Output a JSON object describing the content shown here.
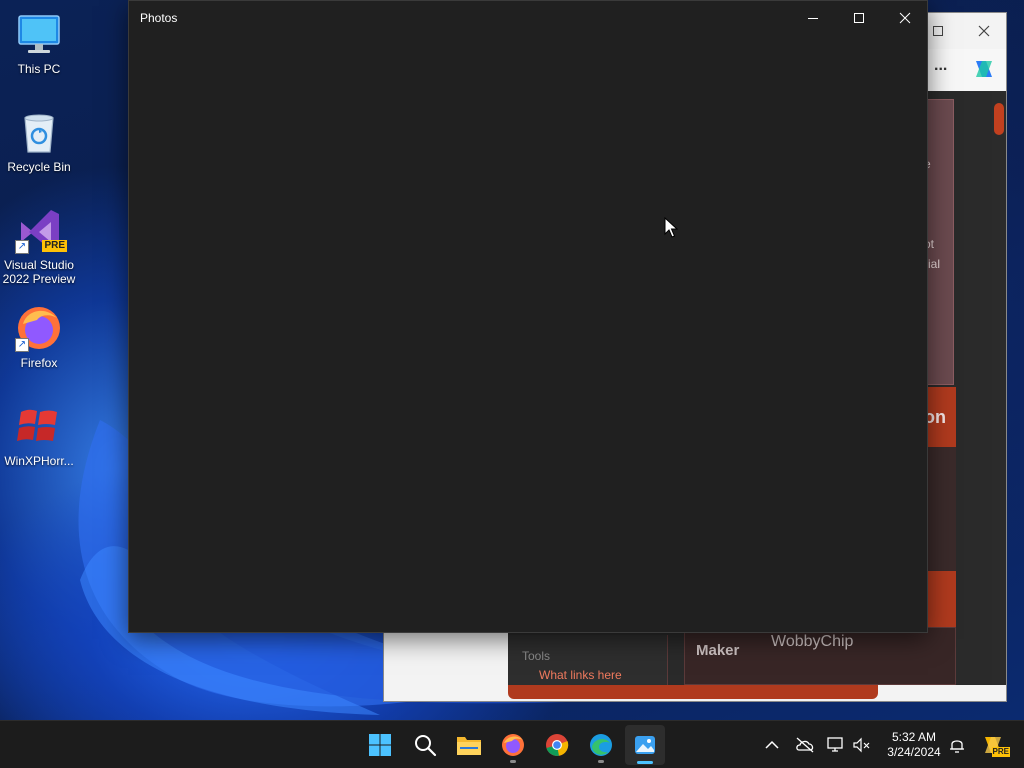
{
  "desktop": {
    "icons": [
      {
        "label": "This PC",
        "icon": "monitor-icon"
      },
      {
        "label": "Recycle Bin",
        "icon": "recycle-bin-icon"
      },
      {
        "label": "Visual Studio 2022 Preview",
        "icon": "visual-studio-icon",
        "badge": "PRE"
      },
      {
        "label": "Firefox",
        "icon": "firefox-icon"
      },
      {
        "label": "WinXPHorr...",
        "icon": "windows-flag-icon"
      }
    ]
  },
  "photos_window": {
    "title": "Photos",
    "minimize_icon": "minimize-icon",
    "maximize_icon": "maximize-icon",
    "close_icon": "close-icon"
  },
  "browser_window": {
    "more_label": "...",
    "copilot_icon": "copilot-icon",
    "visible_text": {
      "frag_e": "e",
      "frag_ot": "ot",
      "frag_rial": "rial",
      "frag_on": "on",
      "tools_heading": "Tools",
      "what_links_here": "What links here",
      "maker_label": "Maker",
      "maker_value": "WobbyChip"
    }
  },
  "taskbar": {
    "apps": [
      {
        "name": "start-button",
        "icon": "windows-logo-icon"
      },
      {
        "name": "search-button",
        "icon": "search-icon"
      },
      {
        "name": "file-explorer-button",
        "icon": "folder-icon"
      },
      {
        "name": "firefox-taskbar-button",
        "icon": "firefox-icon"
      },
      {
        "name": "chrome-taskbar-button",
        "icon": "chrome-icon"
      },
      {
        "name": "edge-taskbar-button",
        "icon": "edge-icon"
      },
      {
        "name": "photos-taskbar-button",
        "icon": "photos-icon",
        "active": true
      }
    ],
    "tray": {
      "time": "5:32 AM",
      "date": "3/24/2024",
      "badge": "PRE"
    }
  },
  "colors": {
    "photos_bg": "#202020",
    "taskbar_bg": "#1c1c1c",
    "accent": "#4cc2ff",
    "wiki_accent": "#b03a1e"
  }
}
